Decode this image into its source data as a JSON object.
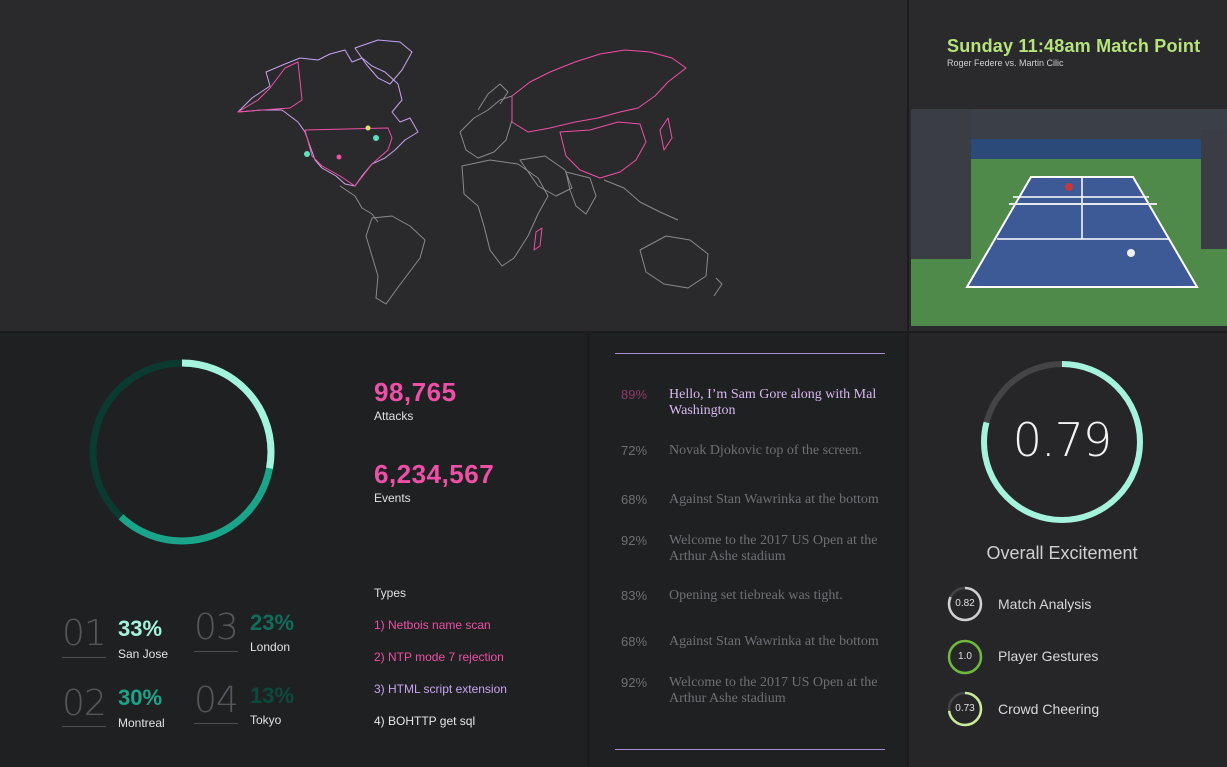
{
  "header": {
    "title": "Sunday 11:48am Match Point",
    "subtitle": "Roger Federe vs. Martin Cilic"
  },
  "colors": {
    "accent_pink": "#ee4fa7",
    "accent_green": "#b6e37a",
    "accent_mint": "#a6f3dd",
    "accent_teal": "#1aa58a",
    "accent_purple": "#c7a3ef"
  },
  "stats": {
    "attacks_value": "98,765",
    "attacks_label": "Attacks",
    "events_value": "6,234,567",
    "events_label": "Events",
    "donut_fill": 0.62
  },
  "types": {
    "title": "Types",
    "items": [
      {
        "label": "1) Netbois name scan",
        "color": "#ee4fa7"
      },
      {
        "label": "2) NTP mode 7 rejection",
        "color": "#ee4fa7"
      },
      {
        "label": "3) HTML script extension",
        "color": "#c7a3ef"
      },
      {
        "label": "4) BOHTTP get sql",
        "color": "#e6e6e6"
      }
    ]
  },
  "cities": [
    {
      "index": "01",
      "percent": "33%",
      "name": "San Jose",
      "color": "#a6f3dd"
    },
    {
      "index": "03",
      "percent": "23%",
      "name": "London",
      "color": "#0f6d5a"
    },
    {
      "index": "02",
      "percent": "30%",
      "name": "Montreal",
      "color": "#1aa58a"
    },
    {
      "index": "04",
      "percent": "13%",
      "name": "Tokyo",
      "color": "#0c4a3d"
    }
  ],
  "transcript": [
    {
      "percent": "89%",
      "text": "Hello, I’m Sam Gore along with Mal Washington"
    },
    {
      "percent": "72%",
      "text": "Novak Djokovic top of the screen."
    },
    {
      "percent": "68%",
      "text": "Against Stan Wawrinka at the bottom"
    },
    {
      "percent": "92%",
      "text": "Welcome to the 2017 US Open at the Arthur Ashe stadium"
    },
    {
      "percent": "83%",
      "text": "Opening set tiebreak was tight."
    },
    {
      "percent": "68%",
      "text": "Against Stan Wawrinka at the bottom"
    },
    {
      "percent": "92%",
      "text": "Welcome to the 2017 US Open at the Arthur Ashe stadium"
    }
  ],
  "excitement": {
    "score": "0.79",
    "score_value": 0.79,
    "label": "Overall Excitement",
    "metrics": [
      {
        "value": "0.82",
        "fraction": 0.82,
        "label": "Match Analysis",
        "color": "#d0d0d0"
      },
      {
        "value": "1.0",
        "fraction": 1.0,
        "label": "Player Gestures",
        "color": "#6fb83a"
      },
      {
        "value": "0.73",
        "fraction": 0.73,
        "label": "Crowd Cheering",
        "color": "#c9ec9a"
      }
    ]
  }
}
